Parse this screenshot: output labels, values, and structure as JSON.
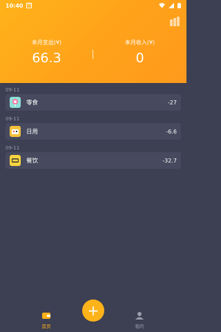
{
  "status": {
    "time": "10:40"
  },
  "summary": {
    "expense_label": "本月支出(¥)",
    "expense_value": "66.3",
    "income_label": "本月收入(¥)",
    "income_value": "0"
  },
  "records": [
    {
      "date": "09-11",
      "category": "零食",
      "amount": "-27",
      "icon": "lollipop-icon",
      "icon_bg": "#8ee0d8"
    },
    {
      "date": "09-11",
      "category": "日用",
      "amount": "-6.6",
      "icon": "daily-goods-icon",
      "icon_bg": "#f6c23a"
    },
    {
      "date": "09-11",
      "category": "餐饮",
      "amount": "-32.7",
      "icon": "food-icon",
      "icon_bg": "#f7d43f"
    }
  ],
  "nav": {
    "home_label": "首页",
    "me_label": "我的",
    "add_label": "+"
  },
  "colors": {
    "accent": "#ffb31a",
    "background": "#3d3f52",
    "row_bg": "#474a5e"
  }
}
